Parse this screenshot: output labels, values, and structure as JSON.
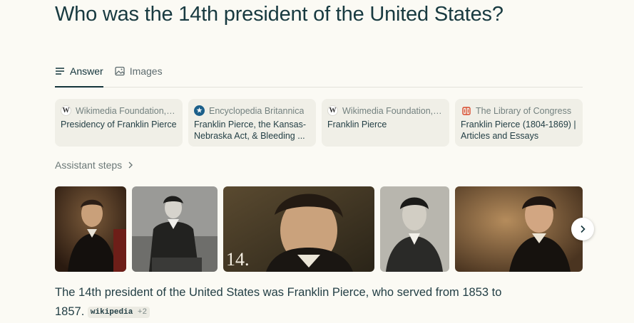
{
  "question": "Who was the 14th president of the United States?",
  "tabs": [
    {
      "label": "Answer",
      "icon": "list-icon",
      "active": true
    },
    {
      "label": "Images",
      "icon": "image-icon",
      "active": false
    }
  ],
  "sources": [
    {
      "site": "Wikimedia Foundation, I...",
      "title": "Presidency of Franklin Pierce",
      "icon": "wikipedia-icon"
    },
    {
      "site": "Encyclopedia Britannica",
      "title": "Franklin Pierce, the Kansas-Nebraska Act, & Bleeding ...",
      "icon": "britannica-icon"
    },
    {
      "site": "Wikimedia Foundation, I...",
      "title": "Franklin Pierce",
      "icon": "wikipedia-icon"
    },
    {
      "site": "The Library of Congress",
      "title": "Franklin Pierce (1804-1869) | Articles and Essays",
      "icon": "library-of-congress-icon"
    }
  ],
  "assistant_steps_label": "Assistant steps",
  "images": [
    {
      "alt": "Portrait of Franklin Pierce"
    },
    {
      "alt": "Seated photograph of Franklin Pierce"
    },
    {
      "alt": "Franklin Pierce close-up",
      "caption": "14."
    },
    {
      "alt": "Black and white photo of Franklin Pierce"
    },
    {
      "alt": "Painted portrait of Franklin Pierce"
    }
  ],
  "answer": {
    "text": "The 14th president of the United States was Franklin Pierce, who served from 1853 to 1857.",
    "citation": "wikipedia",
    "citation_more": "+2"
  },
  "colors": {
    "background": "#fbfaf4",
    "text": "#13343b",
    "card": "#f0efe7"
  }
}
